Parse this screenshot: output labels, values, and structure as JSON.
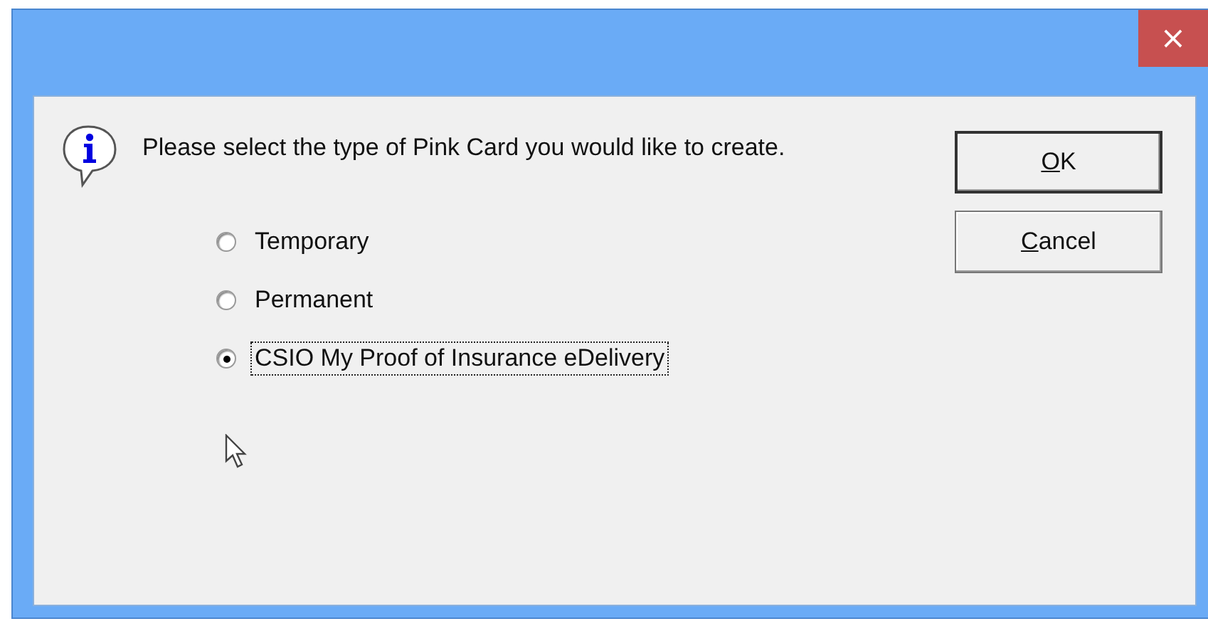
{
  "window": {
    "close_label": "×"
  },
  "message": "Please select the type of Pink Card you would like to create.",
  "buttons": [
    {
      "key": "O",
      "rest": "K",
      "default": true
    },
    {
      "key": "C",
      "rest": "ancel",
      "default": false
    }
  ],
  "options": [
    {
      "label": "Temporary",
      "selected": false,
      "focused": false
    },
    {
      "label": "Permanent",
      "selected": false,
      "focused": false
    },
    {
      "label": "CSIO My Proof of Insurance eDelivery",
      "selected": true,
      "focused": true
    }
  ]
}
